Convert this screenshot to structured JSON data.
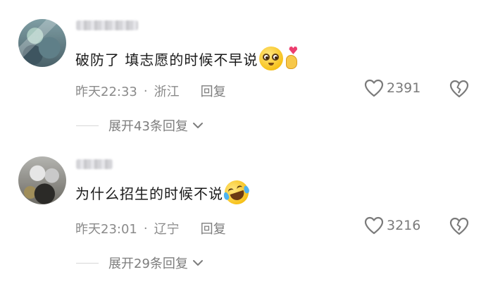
{
  "comments": [
    {
      "username": "",
      "text": "破防了 填志愿的时候不早说",
      "emojis": [
        "flushed-face",
        "heart-hand"
      ],
      "time": "昨天22:33",
      "separator": "·",
      "location": "浙江",
      "reply_label": "回复",
      "likes": "2391",
      "expand_label": "展开43条回复"
    },
    {
      "username": "",
      "text": "为什么招生的时候不说",
      "emojis": [
        "rolling-laughing-face"
      ],
      "time": "昨天23:01",
      "separator": "·",
      "location": "辽宁",
      "reply_label": "回复",
      "likes": "3216",
      "expand_label": "展开29条回复"
    }
  ],
  "colors": {
    "text": "#1a1a1a",
    "meta": "#8a8a8a",
    "background": "#ffffff"
  }
}
